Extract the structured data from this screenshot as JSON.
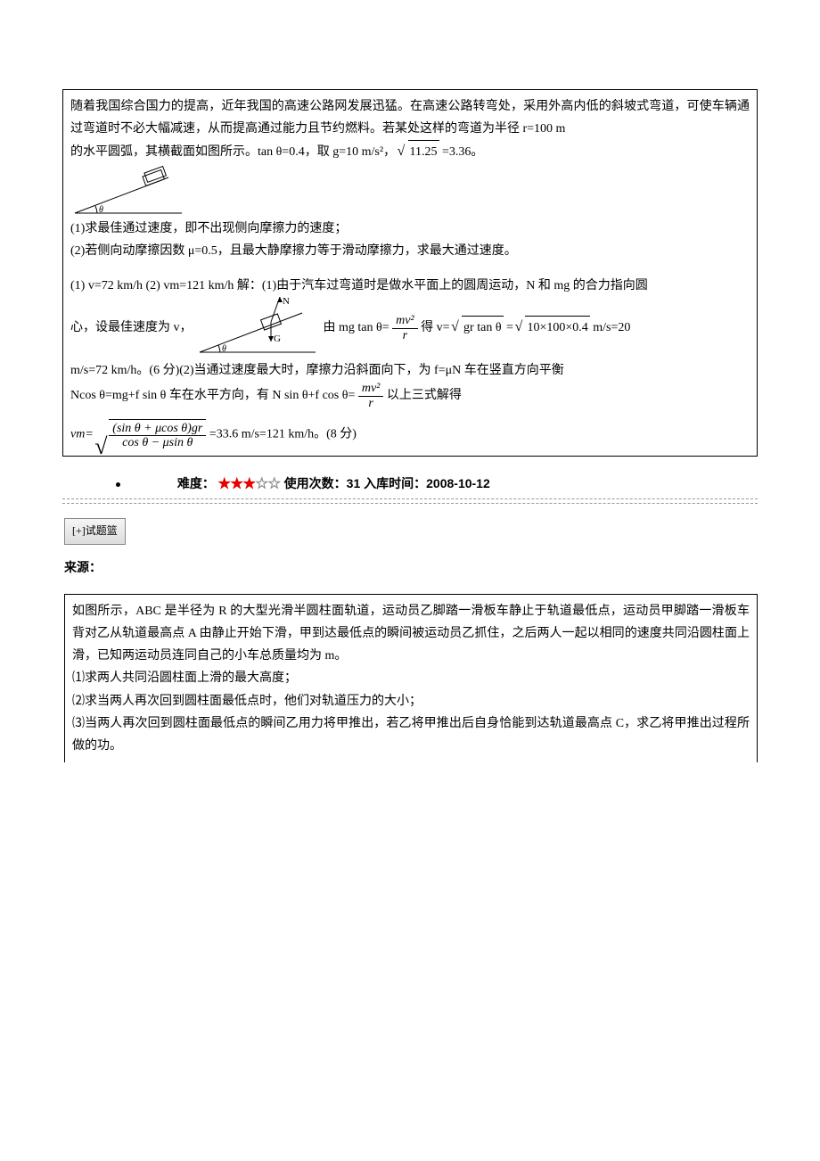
{
  "q1": {
    "p1": "随着我国综合国力的提高，近年我国的高速公路网发展迅猛。在高速公路转弯处，采用外高内低的斜坡式弯道，可使车辆通过弯道时不必大幅减速，从而提高通过能力且节约燃料。若某处这样的弯道为半径 r=100 m",
    "p2a": "的水平圆弧，其横截面如图所示。tan θ=0.4，取 g=10 m/s²，",
    "sqrt1": "11.25",
    "p2b": "=3.36。",
    "item1": "(1)求最佳通过速度，即不出现侧向摩擦力的速度；",
    "item2": "(2)若侧向动摩擦因数 μ=0.5，且最大静摩擦力等于滑动摩擦力，求最大通过速度。",
    "ans1a": " (1) v=72 km/h (2) vm=121 km/h 解：(1)由于汽车过弯道时是做水平面上的圆周运动，N 和 mg 的合力指向圆",
    "ans1b_pre": "心，设最佳速度为 v，",
    "ans1b_mid": "由 mg tan θ=",
    "frac1_num": "mv²",
    "frac1_den": "r",
    "ans1b_aft": " 得 v=",
    "sqrt2_inner": "gr tan θ",
    "eq": "=",
    "sqrt3_inner": "10×100×0.4",
    "ans1b_end": " m/s=20",
    "ans1c": "m/s=72 km/h。(6 分)(2)当通过速度最大时，摩擦力沿斜面向下，为 f=μN 车在竖直方向平衡",
    "ans1d_pre": "Ncos θ=mg+f sin θ 车在水平方向，有 N sin θ+f cos θ= ",
    "frac2_num": "mv²",
    "frac2_den": "r",
    "ans1d_aft": " 以上三式解得",
    "vm_label": "vm=",
    "sqrt4_num": "(sin θ + μcos θ)gr",
    "sqrt4_den": "cos θ − μsin θ",
    "ans1e": "=33.6 m/s=121 km/h。(8 分)"
  },
  "meta": {
    "difficulty_label": "难度：",
    "stars_full": "★★★",
    "stars_empty": "☆☆",
    "usage_label": "使用次数：",
    "usage_count": "31",
    "entry_label": " 入库时间：",
    "entry_date": "2008-10-12"
  },
  "basket_button": "[+]试题篮",
  "source_label": "来源：",
  "q2": {
    "p1": "如图所示，ABC 是半径为 R 的大型光滑半圆柱面轨道，运动员乙脚踏一滑板车静止于轨道最低点，运动员甲脚踏一滑板车背对乙从轨道最高点 A 由静止开始下滑，甲到达最低点的瞬间被运动员乙抓住，之后两人一起以相同的速度共同沿圆柱面上滑，已知两运动员连同自己的小车总质量均为 m。",
    "i1": "⑴求两人共同沿圆柱面上滑的最大高度；",
    "i2": "⑵求当两人再次回到圆柱面最低点时，他们对轨道压力的大小；",
    "i3": "⑶当两人再次回到圆柱面最低点的瞬间乙用力将甲推出，若乙将甲推出后自身恰能到达轨道最高点 C，求乙将甲推出过程所做的功。"
  }
}
